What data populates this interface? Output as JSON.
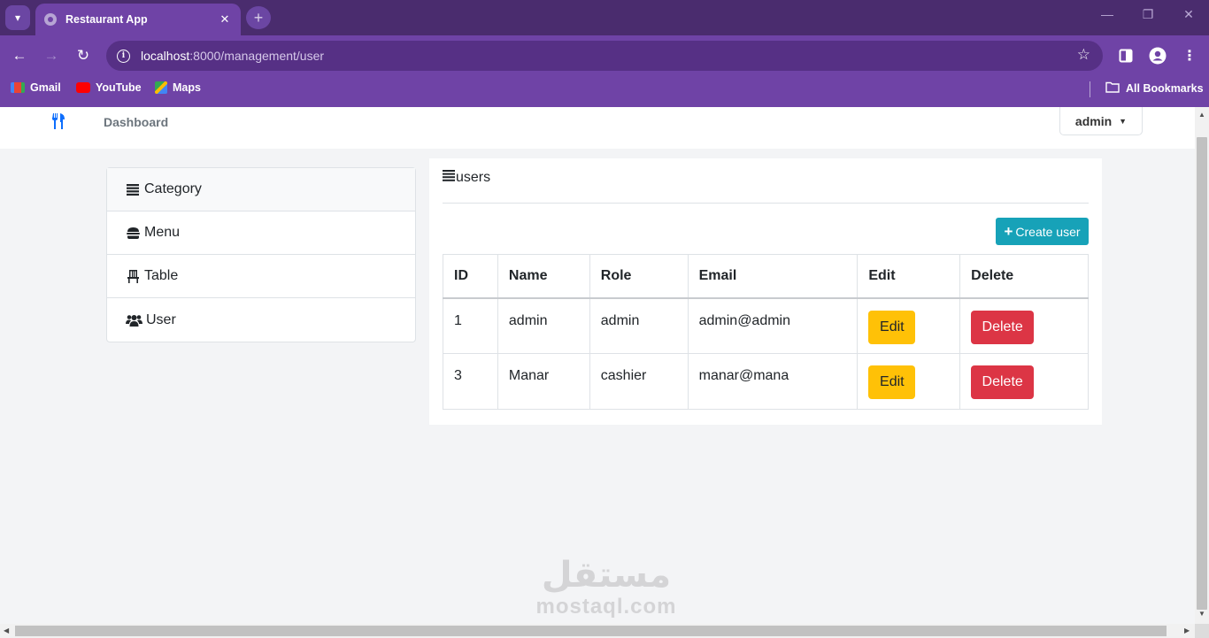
{
  "browser": {
    "tab_title": "Restaurant App",
    "url_host": "localhost",
    "url_path": ":8000/management/user",
    "bookmarks": [
      {
        "label": "Gmail",
        "icon": "gmail-icon",
        "color": "#ea4335"
      },
      {
        "label": "YouTube",
        "icon": "youtube-icon",
        "color": "#ff0000"
      },
      {
        "label": "Maps",
        "icon": "maps-icon",
        "color": "#34a853"
      }
    ],
    "all_bookmarks": "All Bookmarks"
  },
  "navbar": {
    "brand_icon": "utensils-icon",
    "dashboard_link": "Dashboard",
    "user_menu": "admin"
  },
  "sidebar": {
    "items": [
      {
        "label": "Category",
        "icon": "list-icon"
      },
      {
        "label": "Menu",
        "icon": "hamburger-icon"
      },
      {
        "label": "Table",
        "icon": "chair-icon"
      },
      {
        "label": "User",
        "icon": "users-icon"
      }
    ]
  },
  "users_card": {
    "title": "users",
    "create_button": "Create user",
    "columns": [
      "ID",
      "Name",
      "Role",
      "Email",
      "Edit",
      "Delete"
    ],
    "rows": [
      {
        "id": "1",
        "name": "admin",
        "role": "admin",
        "email": "admin@admin",
        "edit": "Edit",
        "delete": "Delete"
      },
      {
        "id": "3",
        "name": "Manar",
        "role": "cashier",
        "email": "manar@mana",
        "edit": "Edit",
        "delete": "Delete"
      }
    ]
  },
  "watermark": {
    "logo": "مستقل",
    "text": "mostaql.com"
  },
  "colors": {
    "browser_purple": "#6f43a6",
    "primary_blue": "#0d6efd",
    "info_teal": "#17a2b8",
    "warning_yellow": "#ffc107",
    "danger_red": "#dc3545"
  }
}
